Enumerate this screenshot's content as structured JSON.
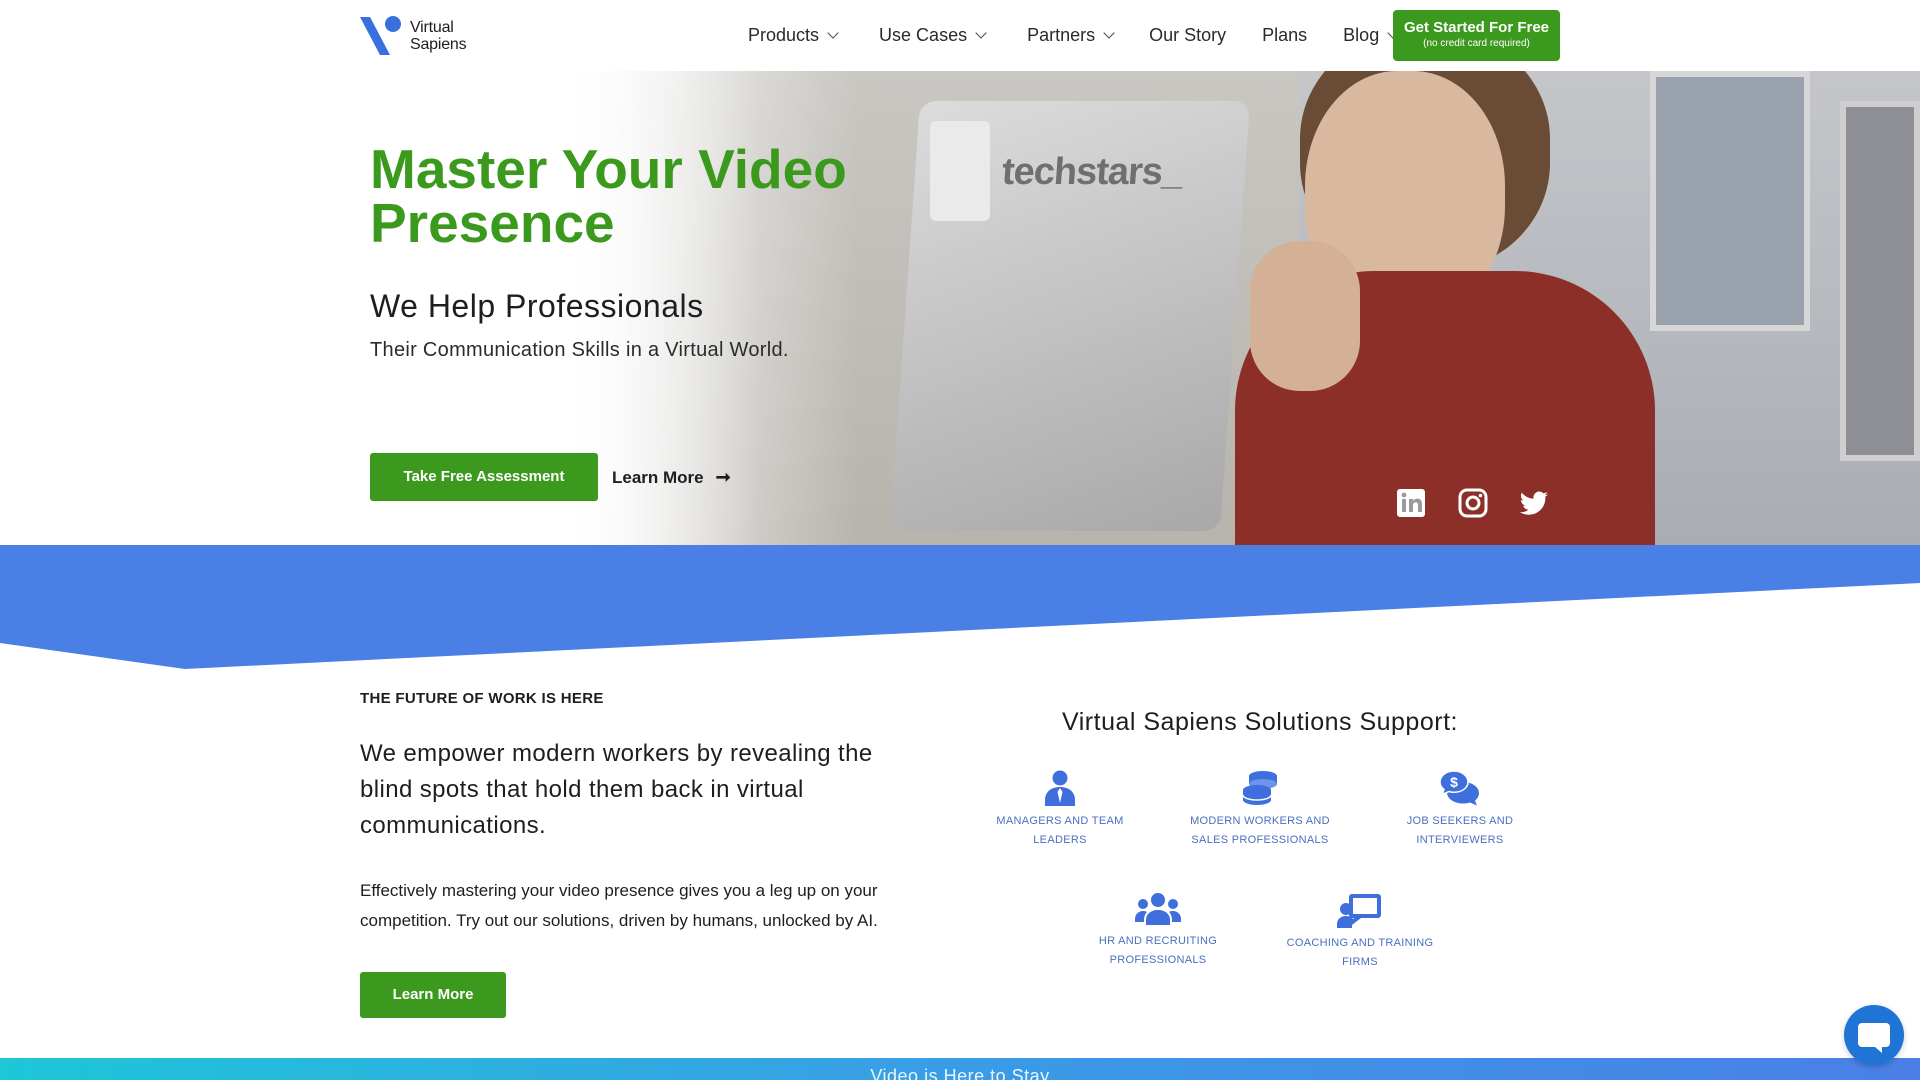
{
  "nav": {
    "logo_line1": "Virtual",
    "logo_line2": "Sapiens",
    "items": [
      {
        "label": "Products",
        "dropdown": true
      },
      {
        "label": "Use Cases",
        "dropdown": true
      },
      {
        "label": "Partners",
        "dropdown": true
      },
      {
        "label": "Our Story",
        "dropdown": false
      },
      {
        "label": "Plans",
        "dropdown": false
      },
      {
        "label": "Blog",
        "dropdown": true
      }
    ],
    "cta_label": "Get Started For Free",
    "cta_sub": "(no credit card required)"
  },
  "hero": {
    "title": "Master Your Video Presence",
    "subtitle": "We Help Professionals",
    "description": "Their Communication Skills in a Virtual World.",
    "assess_label": "Take Free Assessment",
    "learn_label": "Learn More",
    "laptop_brand": "techstars_",
    "social": [
      "linkedin-icon",
      "instagram-icon",
      "twitter-icon"
    ]
  },
  "section": {
    "eyebrow": "THE FUTURE OF WORK IS HERE",
    "lead": "We empower modern workers by revealing the blind spots that hold them back in virtual communications.",
    "body": "Effectively mastering your video presence gives you a leg up on your competition. Try out our solutions, driven by humans, unlocked by AI.",
    "learn_label": "Learn More",
    "support_title": "Virtual Sapiens Solutions Support:",
    "audiences": [
      {
        "label": "MANAGERS AND TEAM LEADERS",
        "icon": "manager-icon"
      },
      {
        "label": "MODERN WORKERS AND SALES PROFESSIONALS",
        "icon": "coins-icon"
      },
      {
        "label": "JOB SEEKERS AND INTERVIEWERS",
        "icon": "chat-dollar-icon"
      },
      {
        "label": "HR AND RECRUITING PROFESSIONALS",
        "icon": "team-icon"
      },
      {
        "label": "COACHING AND TRAINING FIRMS",
        "icon": "presenter-icon"
      }
    ]
  },
  "footer": {
    "strip_text": "Video is Here to Stay"
  },
  "colors": {
    "brand_green": "#3b9a1d",
    "brand_blue": "#4a7fe6",
    "audience_text": "#4a6fbf"
  }
}
